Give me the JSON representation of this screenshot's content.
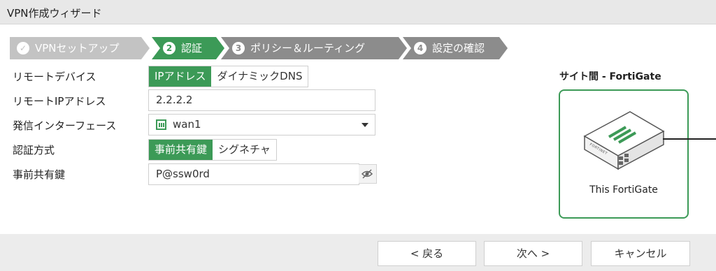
{
  "window": {
    "title": "VPN作成ウィザード"
  },
  "steps": [
    {
      "label": "VPNセットアップ",
      "state": "done",
      "color": "#c3c3c3"
    },
    {
      "num": "2",
      "label": "認証",
      "state": "active",
      "color": "#3c9a57"
    },
    {
      "num": "3",
      "label": "ポリシー＆ルーティング",
      "state": "pending",
      "color": "#8c8c8c"
    },
    {
      "num": "4",
      "label": "設定の確認",
      "state": "pending",
      "color": "#8c8c8c"
    }
  ],
  "form": {
    "remote_device": {
      "label": "リモートデバイス",
      "options": [
        "IPアドレス",
        "ダイナミックDNS"
      ],
      "selected": "IPアドレス"
    },
    "remote_ip": {
      "label": "リモートIPアドレス",
      "value": "2.2.2.2"
    },
    "outgoing_interface": {
      "label": "発信インターフェース",
      "value": "wan1",
      "icon": "interface-port-icon"
    },
    "auth_method": {
      "label": "認証方式",
      "options": [
        "事前共有鍵",
        "シグネチャ"
      ],
      "selected": "事前共有鍵"
    },
    "psk": {
      "label": "事前共有鍵",
      "value": "P@ssw0rd",
      "toggle_icon": "eye-slash-icon"
    }
  },
  "diagram": {
    "title": "サイト間 - FortiGate",
    "device_label": "This FortiGate",
    "device_brand": "FORTINET",
    "accent": "#3c9a57"
  },
  "footer": {
    "back": "< 戻る",
    "next": "次へ >",
    "cancel": "キャンセル"
  }
}
